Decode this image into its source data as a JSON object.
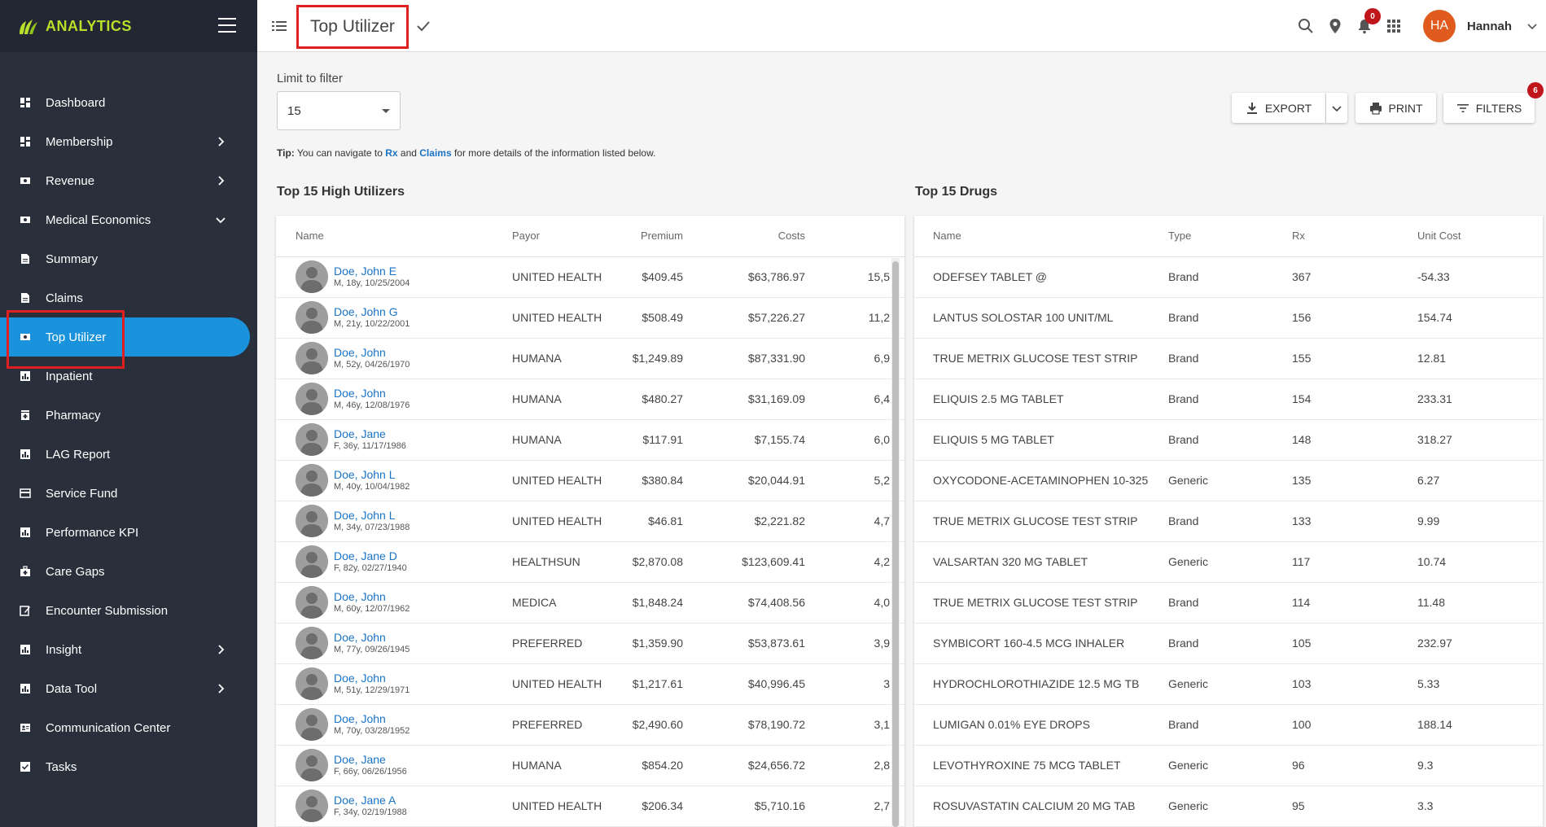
{
  "brand": {
    "name": "ANALYTICS"
  },
  "sidebar": {
    "items": [
      {
        "label": "Dashboard",
        "icon": "dashboard-icon"
      },
      {
        "label": "Membership",
        "icon": "dashboard-icon",
        "chevron": "right"
      },
      {
        "label": "Revenue",
        "icon": "money-icon",
        "chevron": "right"
      },
      {
        "label": "Medical Economics",
        "icon": "money-icon",
        "chevron": "down"
      },
      {
        "label": "Summary",
        "icon": "document-icon"
      },
      {
        "label": "Claims",
        "icon": "document-icon"
      },
      {
        "label": "Top Utilizer",
        "icon": "money-icon",
        "active": true
      },
      {
        "label": "Inpatient",
        "icon": "chart-icon"
      },
      {
        "label": "Pharmacy",
        "icon": "pharmacy-icon"
      },
      {
        "label": "LAG Report",
        "icon": "chart-icon"
      },
      {
        "label": "Service Fund",
        "icon": "card-icon"
      },
      {
        "label": "Performance KPI",
        "icon": "chart-icon"
      },
      {
        "label": "Care Gaps",
        "icon": "medkit-icon"
      },
      {
        "label": "Encounter Submission",
        "icon": "edit-icon"
      },
      {
        "label": "Insight",
        "icon": "chart-icon",
        "chevron": "right"
      },
      {
        "label": "Data Tool",
        "icon": "chart-icon",
        "chevron": "right"
      },
      {
        "label": "Communication Center",
        "icon": "contact-icon"
      },
      {
        "label": "Tasks",
        "icon": "task-icon"
      }
    ]
  },
  "header": {
    "title": "Top Utilizer",
    "notifications_count": "0",
    "user": {
      "initials": "HA",
      "name": "Hannah"
    }
  },
  "filter": {
    "label": "Limit to filter",
    "value": "15"
  },
  "tip": {
    "prefix": "Tip:",
    "text1": " You can navigate to ",
    "link1": "Rx",
    "text2": " and ",
    "link2": "Claims",
    "text3": " for more details of the information listed below."
  },
  "actions": {
    "export": "EXPORT",
    "print": "PRINT",
    "filters": "FILTERS",
    "filters_count": "6"
  },
  "utilizers": {
    "title": "Top 15 High Utilizers",
    "columns": [
      "Name",
      "Payor",
      "Premium",
      "Costs",
      ""
    ],
    "rows": [
      {
        "name": "Doe, John E",
        "meta": "M, 18y, 10/25/2004",
        "payor": "UNITED HEALTHCARE",
        "premium": "$409.45",
        "costs": "$63,786.97",
        "extra": "15,5"
      },
      {
        "name": "Doe, John G",
        "meta": "M, 21y, 10/22/2001",
        "payor": "UNITED HEALTHCARE",
        "premium": "$508.49",
        "costs": "$57,226.27",
        "extra": "11,2"
      },
      {
        "name": "Doe, John",
        "meta": "M, 52y, 04/26/1970",
        "payor": "HUMANA",
        "premium": "$1,249.89",
        "costs": "$87,331.90",
        "extra": "6,9"
      },
      {
        "name": "Doe, John",
        "meta": "M, 46y, 12/08/1976",
        "payor": "HUMANA",
        "premium": "$480.27",
        "costs": "$31,169.09",
        "extra": "6,4"
      },
      {
        "name": "Doe, Jane",
        "meta": "F, 36y, 11/17/1986",
        "payor": "HUMANA",
        "premium": "$117.91",
        "costs": "$7,155.74",
        "extra": "6,0"
      },
      {
        "name": "Doe, John L",
        "meta": "M, 40y, 10/04/1982",
        "payor": "UNITED HEALTHCARE",
        "premium": "$380.84",
        "costs": "$20,044.91",
        "extra": "5,2"
      },
      {
        "name": "Doe, John L",
        "meta": "M, 34y, 07/23/1988",
        "payor": "UNITED HEALTHCARE",
        "premium": "$46.81",
        "costs": "$2,221.82",
        "extra": "4,7"
      },
      {
        "name": "Doe, Jane D",
        "meta": "F, 82y, 02/27/1940",
        "payor": "HEALTHSUN",
        "premium": "$2,870.08",
        "costs": "$123,609.41",
        "extra": "4,2"
      },
      {
        "name": "Doe, John",
        "meta": "M, 60y, 12/07/1962",
        "payor": "MEDICA",
        "premium": "$1,848.24",
        "costs": "$74,408.56",
        "extra": "4,0"
      },
      {
        "name": "Doe, John",
        "meta": "M, 77y, 09/26/1945",
        "payor": "PREFERRED",
        "premium": "$1,359.90",
        "costs": "$53,873.61",
        "extra": "3,9"
      },
      {
        "name": "Doe, John",
        "meta": "M, 51y, 12/29/1971",
        "payor": "UNITED HEALTHCARE",
        "premium": "$1,217.61",
        "costs": "$40,996.45",
        "extra": "3"
      },
      {
        "name": "Doe, John",
        "meta": "M, 70y, 03/28/1952",
        "payor": "PREFERRED",
        "premium": "$2,490.60",
        "costs": "$78,190.72",
        "extra": "3,1"
      },
      {
        "name": "Doe, Jane",
        "meta": "F, 66y, 06/26/1956",
        "payor": "HUMANA",
        "premium": "$854.20",
        "costs": "$24,656.72",
        "extra": "2,8"
      },
      {
        "name": "Doe, Jane A",
        "meta": "F, 34y, 02/19/1988",
        "payor": "UNITED HEALTHCARE",
        "premium": "$206.34",
        "costs": "$5,710.16",
        "extra": "2,7"
      }
    ]
  },
  "drugs": {
    "title": "Top 15 Drugs",
    "columns": [
      "Name",
      "Type",
      "Rx",
      "Unit Cost"
    ],
    "rows": [
      {
        "name": "ODEFSEY TABLET @",
        "type": "Brand",
        "rx": "367",
        "unit_cost": "-54.33"
      },
      {
        "name": "LANTUS SOLOSTAR 100 UNIT/ML",
        "type": "Brand",
        "rx": "156",
        "unit_cost": "154.74"
      },
      {
        "name": "TRUE METRIX GLUCOSE TEST STRIP",
        "type": "Brand",
        "rx": "155",
        "unit_cost": "12.81"
      },
      {
        "name": "ELIQUIS 2.5 MG TABLET",
        "type": "Brand",
        "rx": "154",
        "unit_cost": "233.31"
      },
      {
        "name": "ELIQUIS 5 MG TABLET",
        "type": "Brand",
        "rx": "148",
        "unit_cost": "318.27"
      },
      {
        "name": "OXYCODONE-ACETAMINOPHEN 10-325",
        "type": "Generic",
        "rx": "135",
        "unit_cost": "6.27"
      },
      {
        "name": "TRUE METRIX GLUCOSE TEST STRIP",
        "type": "Brand",
        "rx": "133",
        "unit_cost": "9.99"
      },
      {
        "name": "VALSARTAN 320 MG TABLET",
        "type": "Generic",
        "rx": "117",
        "unit_cost": "10.74"
      },
      {
        "name": "TRUE METRIX GLUCOSE TEST STRIP",
        "type": "Brand",
        "rx": "114",
        "unit_cost": "11.48"
      },
      {
        "name": "SYMBICORT 160-4.5 MCG INHALER",
        "type": "Brand",
        "rx": "105",
        "unit_cost": "232.97"
      },
      {
        "name": "HYDROCHLOROTHIAZIDE 12.5 MG TB",
        "type": "Generic",
        "rx": "103",
        "unit_cost": "5.33"
      },
      {
        "name": "LUMIGAN 0.01% EYE DROPS",
        "type": "Brand",
        "rx": "100",
        "unit_cost": "188.14"
      },
      {
        "name": "LEVOTHYROXINE 75 MCG TABLET",
        "type": "Generic",
        "rx": "96",
        "unit_cost": "9.3"
      },
      {
        "name": "ROSUVASTATIN CALCIUM 20 MG TAB",
        "type": "Generic",
        "rx": "95",
        "unit_cost": "3.3"
      }
    ]
  },
  "colors": {
    "sidebar_bg": "#2a2f3c",
    "active": "#1a93dc",
    "brand": "#b6e02a",
    "link": "#1a73c4",
    "highlight": "#e02020",
    "badge": "#c0151b",
    "avatar": "#e05a1e"
  }
}
